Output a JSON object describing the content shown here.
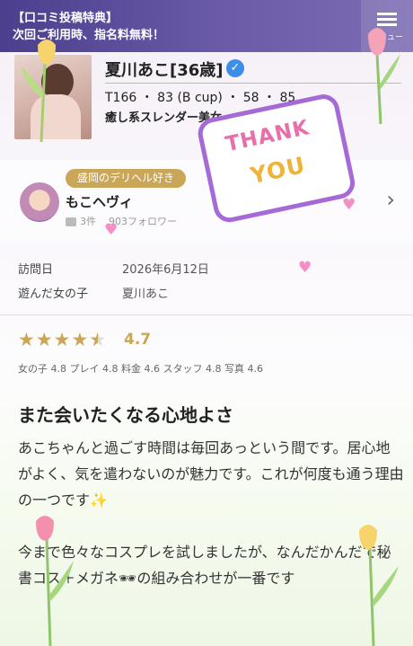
{
  "header": {
    "banner_line1": "【口コミ投稿特典】",
    "banner_line2": "次回ご利用時、指名料無料！",
    "menu_label": "メニュー"
  },
  "profile": {
    "name": "夏川あこ[36歳]",
    "stats": "T166 ・ 83 (B cup) ・ 58 ・ 85",
    "catchphrase": "癒し系スレンダー美女"
  },
  "reviewer": {
    "tag": "盛岡のデリヘル好き",
    "name": "もこヘヴィ",
    "post_count": "3件",
    "followers": "903フォロワー"
  },
  "visit": {
    "date_label": "訪問日",
    "date_value": "2026年6月12日",
    "girl_label": "遊んだ女の子",
    "girl_value": "夏川あこ"
  },
  "rating": {
    "stars": 4.5,
    "score": "4.7",
    "subscores": "女の子 4.8 プレイ 4.8 料金 4.6 スタッフ 4.8 写真 4.6"
  },
  "review": {
    "title": "また会いたくなる心地よさ",
    "para1": "あこちゃんと過ごす時間は毎回あっという間です。居心地がよく、気を遣わないのが魅力です。これが何度も通う理由の一つです",
    "para1_emoji": "✨",
    "para2": "今まで色々なコスプレを試しましたが、なんだかんだで秘書コス＋メガネ🕶の組み合わせが一番です"
  },
  "sticker": {
    "line1": "THANK",
    "line2": "YOU"
  },
  "colors": {
    "header_bg": "#5a4a9c",
    "gold": "#c9a658",
    "verified_blue": "#3d8ee6",
    "heart_pink": "#f48fc6"
  }
}
